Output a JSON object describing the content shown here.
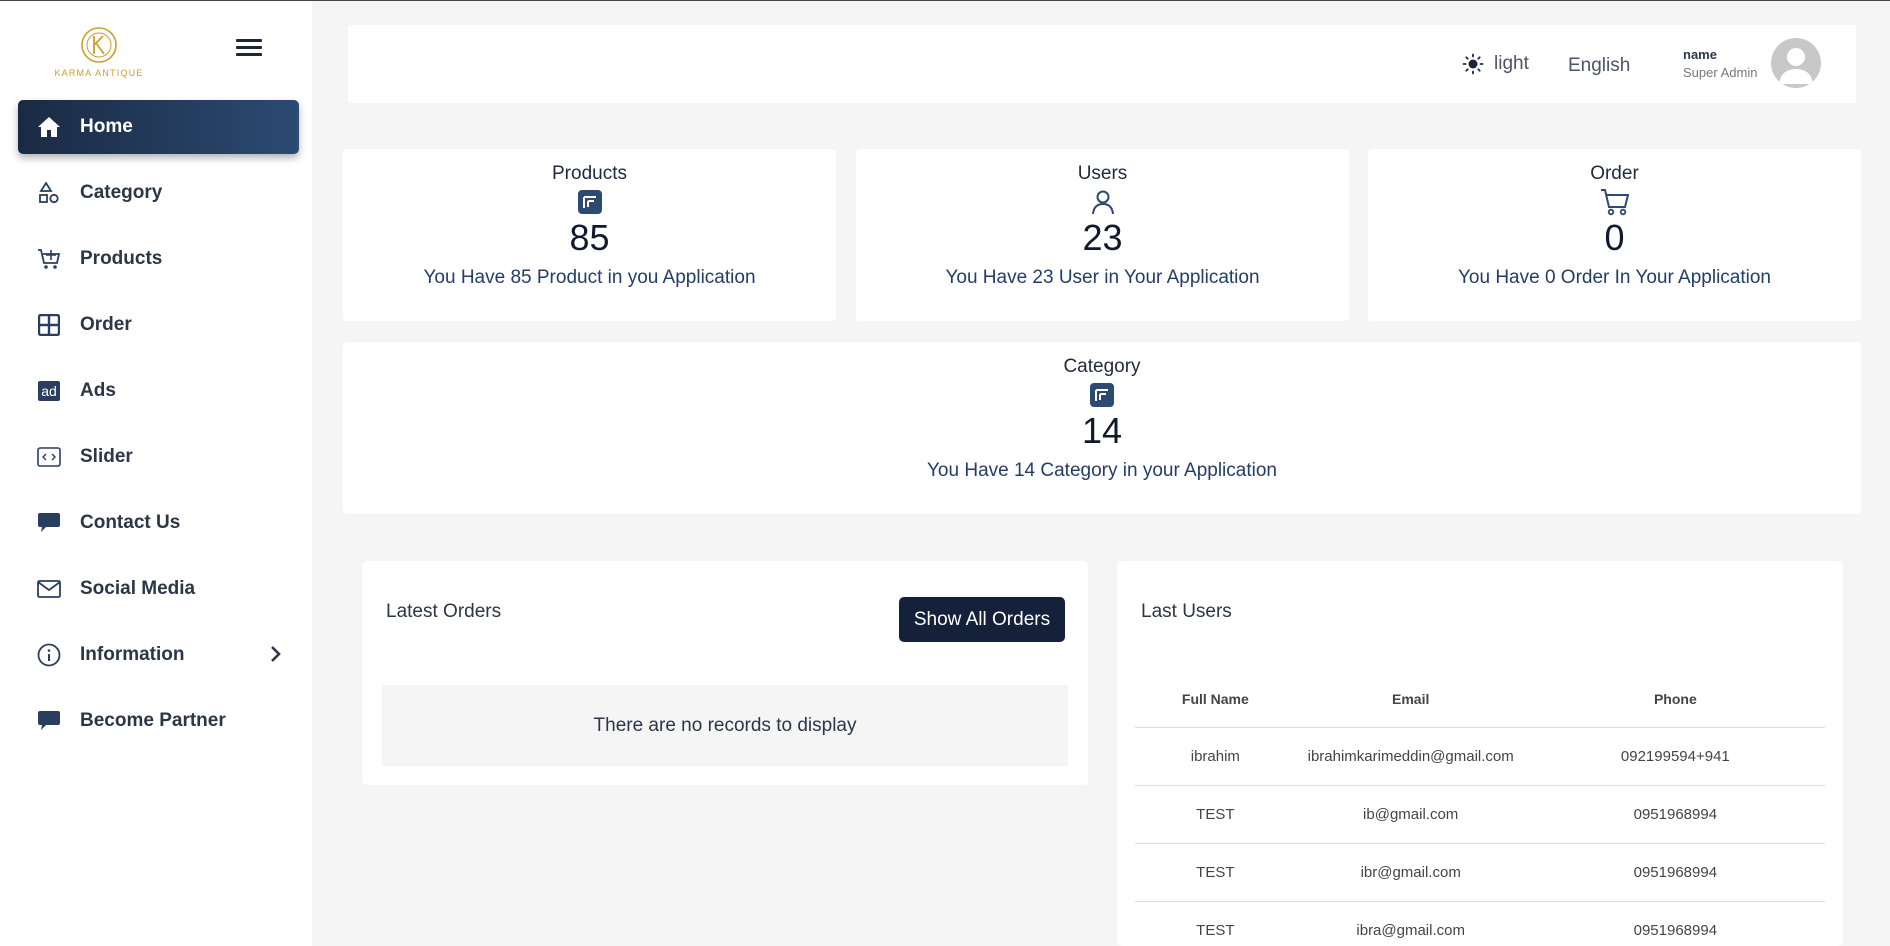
{
  "brand": {
    "name": "KARMA ANTIQUE",
    "color": "#c9a02c"
  },
  "sidebar": {
    "items": [
      {
        "label": "Home",
        "icon": "home-icon",
        "active": true
      },
      {
        "label": "Category",
        "icon": "shapes-icon"
      },
      {
        "label": "Products",
        "icon": "cart-plus-icon"
      },
      {
        "label": "Order",
        "icon": "grid-icon"
      },
      {
        "label": "Ads",
        "icon": "ad-icon"
      },
      {
        "label": "Slider",
        "icon": "code-window-icon"
      },
      {
        "label": "Contact Us",
        "icon": "chat-icon"
      },
      {
        "label": "Social Media",
        "icon": "envelope-icon"
      },
      {
        "label": "Information",
        "icon": "info-icon",
        "has_submenu": true
      },
      {
        "label": "Become Partner",
        "icon": "chat-icon"
      }
    ]
  },
  "header": {
    "theme_label": "light",
    "language": "English",
    "user_name": "name",
    "user_role": "Super Admin"
  },
  "stats": [
    {
      "title": "Products",
      "value": "85",
      "text": "You Have 85 Product in you Application",
      "icon": "product-box-icon"
    },
    {
      "title": "Users",
      "value": "23",
      "text": "You Have 23 User in Your Application",
      "icon": "user-icon"
    },
    {
      "title": "Order",
      "value": "0",
      "text": "You Have 0 Order In Your Application",
      "icon": "cart-icon"
    },
    {
      "title": "Category",
      "value": "14",
      "text": "You Have 14 Category in your Application",
      "icon": "category-box-icon"
    }
  ],
  "latest_orders": {
    "title": "Latest Orders",
    "button": "Show All Orders",
    "empty_text": "There are no records to display"
  },
  "last_users": {
    "title": "Last Users",
    "columns": [
      "Full Name",
      "Email",
      "Phone"
    ],
    "rows": [
      [
        "ibrahim",
        "ibrahimkarimeddin@gmail.com",
        "092199594+941"
      ],
      [
        "TEST",
        "ib@gmail.com",
        "0951968994"
      ],
      [
        "TEST",
        "ibr@gmail.com",
        "0951968994"
      ],
      [
        "TEST",
        "ibra@gmail.com",
        "0951968994"
      ]
    ]
  },
  "colors": {
    "accent": "#2c4a72",
    "dark": "#15213a",
    "background": "#f5f5f5"
  }
}
